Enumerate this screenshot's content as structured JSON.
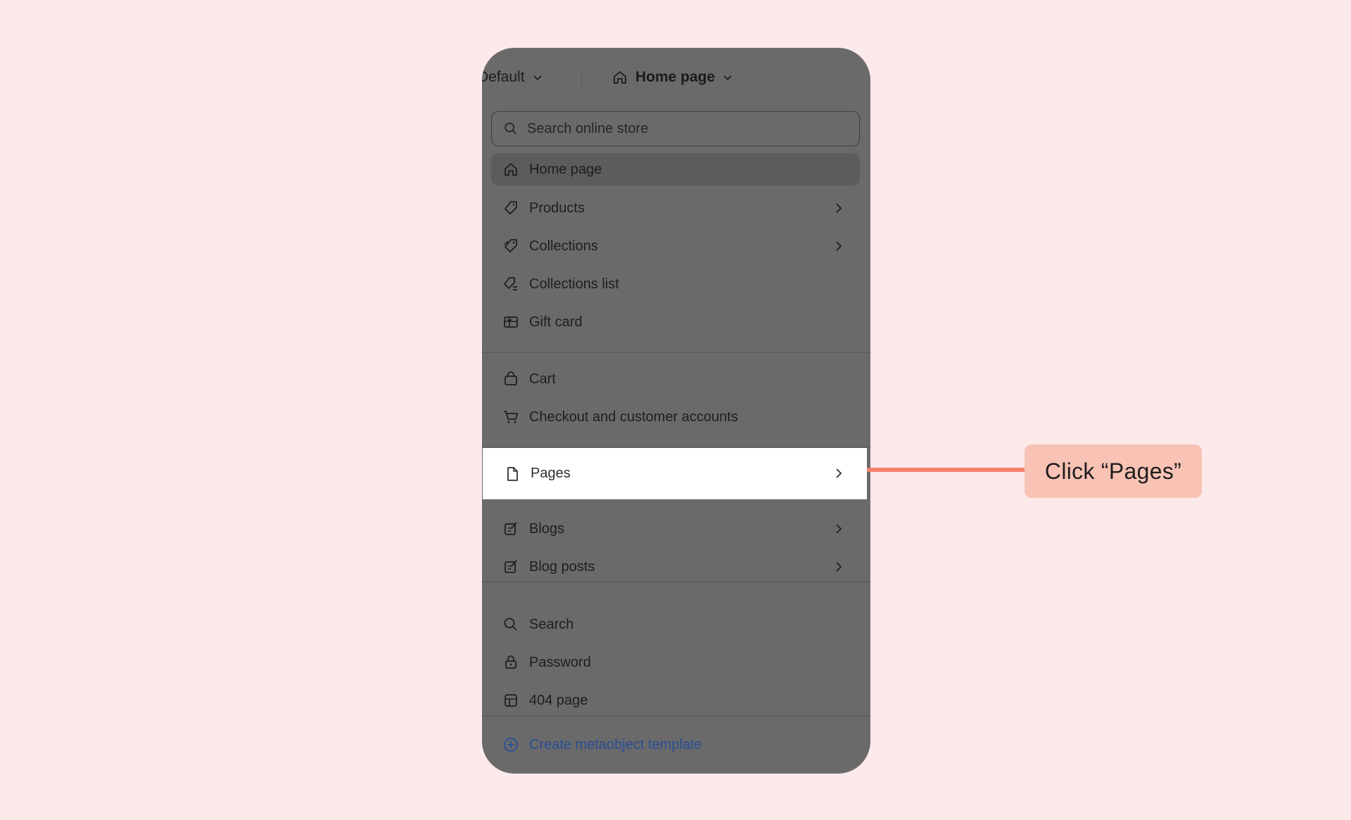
{
  "topbar": {
    "theme_label": "Default",
    "page_label": "Home page"
  },
  "search": {
    "placeholder": "Search online store"
  },
  "menu": {
    "group1": [
      {
        "label": "Home page",
        "icon": "home-icon",
        "selected": true
      },
      {
        "label": "Products",
        "icon": "tag-icon",
        "has_submenu": true
      },
      {
        "label": "Collections",
        "icon": "collection-icon",
        "has_submenu": true
      },
      {
        "label": "Collections list",
        "icon": "collections-list-icon"
      },
      {
        "label": "Gift card",
        "icon": "gift-card-icon"
      }
    ],
    "group2": [
      {
        "label": "Cart",
        "icon": "bag-icon"
      },
      {
        "label": "Checkout and customer accounts",
        "icon": "cart-icon"
      }
    ],
    "group3": [
      {
        "label": "Pages",
        "icon": "page-icon",
        "has_submenu": true,
        "highlighted": true
      },
      {
        "label": "Blogs",
        "icon": "blog-icon",
        "has_submenu": true
      },
      {
        "label": "Blog posts",
        "icon": "blog-post-icon",
        "has_submenu": true
      }
    ],
    "group4": [
      {
        "label": "Search",
        "icon": "search-icon"
      },
      {
        "label": "Password",
        "icon": "lock-icon"
      },
      {
        "label": "404 page",
        "icon": "error-page-icon"
      }
    ],
    "create_label": "Create metaobject template"
  },
  "callout": {
    "text": "Click “Pages”"
  },
  "colors": {
    "background": "#fce9ea",
    "overlay": "#6a6a6a",
    "callout_bg": "#f8c2b5",
    "connector": "#f4826d",
    "link": "#2a4d96"
  }
}
